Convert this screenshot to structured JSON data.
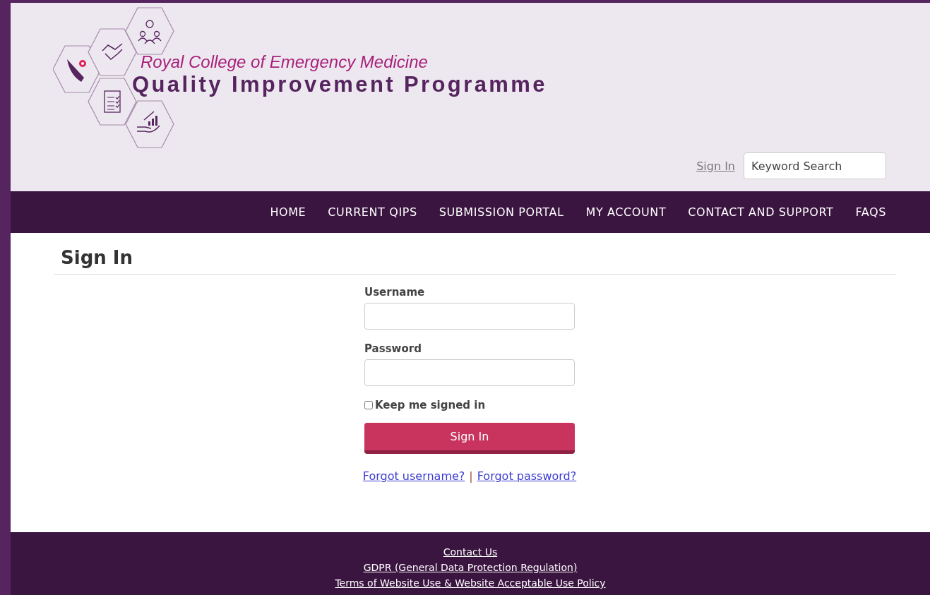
{
  "header": {
    "org_name": "Royal College of Emergency Medicine",
    "programme": "Quality Improvement Programme",
    "sign_in_link": "Sign In",
    "search": {
      "placeholder": "Keyword Search"
    }
  },
  "nav": [
    {
      "label": "HOME"
    },
    {
      "label": "CURRENT QIPS"
    },
    {
      "label": "SUBMISSION PORTAL"
    },
    {
      "label": "MY ACCOUNT"
    },
    {
      "label": "CONTACT AND SUPPORT"
    },
    {
      "label": "FAQS"
    }
  ],
  "page_title": "Sign In",
  "form": {
    "username_label": "Username",
    "password_label": "Password",
    "keep_signed_in": {
      "label": "Keep me signed in",
      "checked": false
    },
    "submit": "Sign In",
    "forgot_username": "Forgot username?",
    "separator": "|",
    "forgot_password": "Forgot password?"
  },
  "footer": [
    "Contact Us",
    "GDPR (General Data Protection Regulation)",
    "Terms of Website Use & Website Acceptable Use Policy"
  ]
}
